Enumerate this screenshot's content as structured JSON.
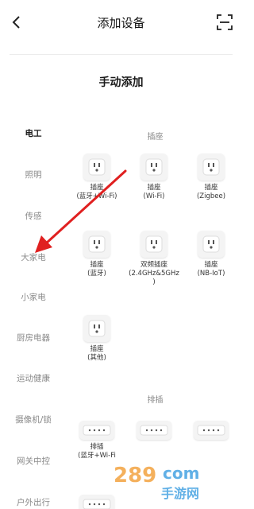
{
  "header": {
    "title": "添加设备"
  },
  "section_title": "手动添加",
  "sidebar": {
    "items": [
      {
        "label": "电工",
        "active": true
      },
      {
        "label": "照明",
        "active": false
      },
      {
        "label": "传感",
        "active": false
      },
      {
        "label": "大家电",
        "active": false
      },
      {
        "label": "小家电",
        "active": false
      },
      {
        "label": "厨房电器",
        "active": false
      },
      {
        "label": "运动健康",
        "active": false
      },
      {
        "label": "摄像机/锁",
        "active": false
      },
      {
        "label": "网关中控",
        "active": false
      },
      {
        "label": "户外出行",
        "active": false
      }
    ]
  },
  "categories": [
    {
      "title": "插座",
      "devices": [
        {
          "label": "插座\n(蓝牙+Wi-Fi)"
        },
        {
          "label": "插座\n(Wi-Fi)"
        },
        {
          "label": "插座\n(Zigbee)"
        },
        {
          "label": "插座\n(蓝牙)"
        },
        {
          "label": "双频插座\n(2.4GHz&5GHz\n)"
        },
        {
          "label": "插座\n(NB-IoT)"
        },
        {
          "label": "插座\n(其他)"
        }
      ]
    },
    {
      "title": "排插",
      "devices": [
        {
          "label": "排插\n(蓝牙+Wi-Fi"
        },
        {
          "label": ""
        },
        {
          "label": ""
        },
        {
          "label": ""
        }
      ]
    }
  ],
  "watermark": {
    "text": "289",
    "suffix": "com",
    "sub": "手游网"
  },
  "colors": {
    "arrow": "#e02020",
    "active_text": "#1a1a1a",
    "inactive_text": "#8a8a8a"
  }
}
